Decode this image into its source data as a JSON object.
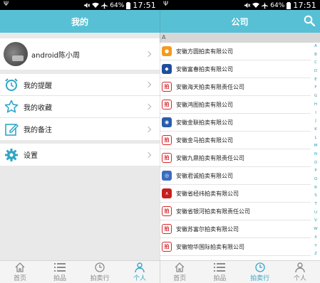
{
  "status": {
    "time": "17:51",
    "battery": "64%"
  },
  "left": {
    "title": "我的",
    "profile_name": "android陈小周",
    "menu": [
      {
        "label": "我的提醒",
        "icon": "alarm-clock-icon"
      },
      {
        "label": "我的收藏",
        "icon": "star-icon"
      },
      {
        "label": "我的备注",
        "icon": "edit-note-icon"
      }
    ],
    "settings_label": "设置"
  },
  "right": {
    "title": "公司",
    "section_letter": "A",
    "companies": [
      "安徽方圆拍卖有限公司",
      "安徽富春拍卖有限公司",
      "安徽海天拍卖有限责任公司",
      "安徽鸿图拍卖有限公司",
      "安徽金联拍卖有限公司",
      "安徽金马拍卖有限公司",
      "安徽九鼎拍卖有限责任公司",
      "安徽君诚拍卖有限公司",
      "安徽省经纬拍卖有限公司",
      "安徽省银河拍卖有限责任公司",
      "安徽苏富尔拍卖有限公司",
      "安徽物华国际拍卖有限公司"
    ],
    "index_letters": [
      "A",
      "B",
      "C",
      "D",
      "E",
      "F",
      "G",
      "H",
      "I",
      "J",
      "K",
      "L",
      "M",
      "N",
      "O",
      "P",
      "Q",
      "R",
      "S",
      "T",
      "U",
      "V",
      "W",
      "X",
      "Y",
      "Z",
      "#"
    ]
  },
  "tabs": [
    {
      "label": "首页",
      "icon": "home-icon"
    },
    {
      "label": "拍品",
      "icon": "list-icon"
    },
    {
      "label": "拍卖行",
      "icon": "clock-icon"
    },
    {
      "label": "个人",
      "icon": "person-icon"
    }
  ],
  "colors": {
    "accent": "#57c0d4",
    "tab_active": "#33a7c7"
  }
}
